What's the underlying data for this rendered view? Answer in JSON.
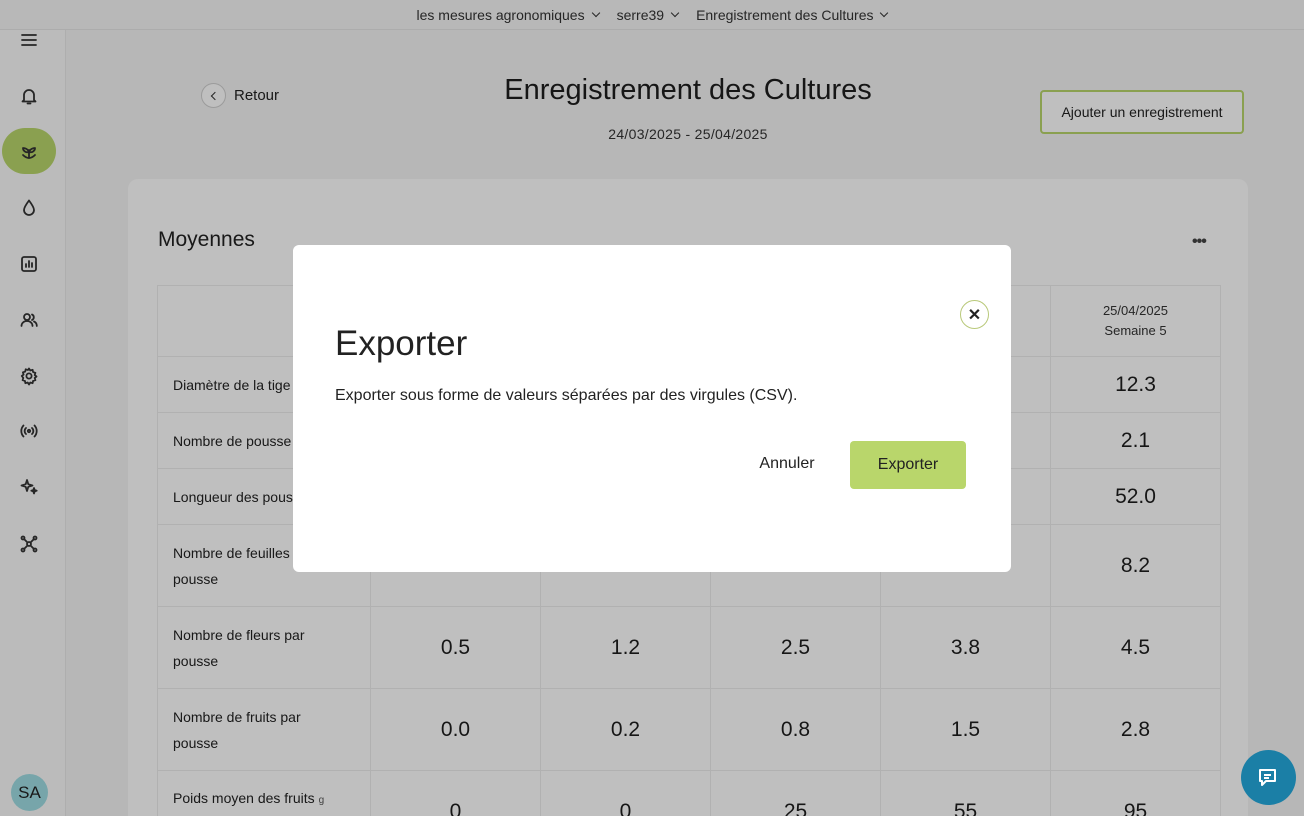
{
  "breadcrumb": [
    "les mesures agronomiques",
    "serre39",
    "Enregistrement des Cultures"
  ],
  "sidebar": {
    "items": [
      "menu-icon",
      "bell-icon",
      "plant-icon",
      "drop-icon",
      "chart-icon",
      "users-icon",
      "gear-icon",
      "broadcast-icon",
      "sparkle-icon",
      "network-icon"
    ],
    "active": "plant-icon",
    "avatar": "SA"
  },
  "header": {
    "back_label": "Retour",
    "title": "Enregistrement des Cultures",
    "date_range": "24/03/2025 - 25/04/2025",
    "add_button": "Ajouter un enregistrement"
  },
  "card": {
    "title": "Moyennes",
    "last_column": {
      "date": "25/04/2025",
      "week": "Semaine 5"
    },
    "rows": [
      {
        "label": "Diamètre de la tige",
        "unit": "",
        "values": [
          "",
          "",
          "",
          "",
          "12.3"
        ]
      },
      {
        "label": "Nombre de pousse",
        "unit": "",
        "values": [
          "",
          "",
          "",
          "",
          "2.1"
        ]
      },
      {
        "label": "Longueur des pous",
        "unit": "",
        "values": [
          "",
          "",
          "",
          "",
          "52.0"
        ]
      },
      {
        "label": "Nombre de feuilles",
        "label2": "pousse",
        "unit": "",
        "values": [
          "",
          "",
          "",
          "",
          "8.2"
        ]
      },
      {
        "label": "Nombre de fleurs par",
        "label2": "pousse",
        "unit": "",
        "values": [
          "0.5",
          "1.2",
          "2.5",
          "3.8",
          "4.5"
        ]
      },
      {
        "label": "Nombre de fruits par",
        "label2": "pousse",
        "unit": "",
        "values": [
          "0.0",
          "0.2",
          "0.8",
          "1.5",
          "2.8"
        ]
      },
      {
        "label": "Poids moyen des fruits",
        "unit": "g",
        "values": [
          "0",
          "0",
          "25",
          "55",
          "95"
        ]
      }
    ]
  },
  "modal": {
    "title": "Exporter",
    "description": "Exporter sous forme de valeurs séparées par des virgules (CSV).",
    "cancel_label": "Annuler",
    "export_label": "Exporter"
  },
  "colors": {
    "accent": "#b9d66b",
    "chat": "#1b7fa6",
    "avatar": "#9fdde3"
  }
}
